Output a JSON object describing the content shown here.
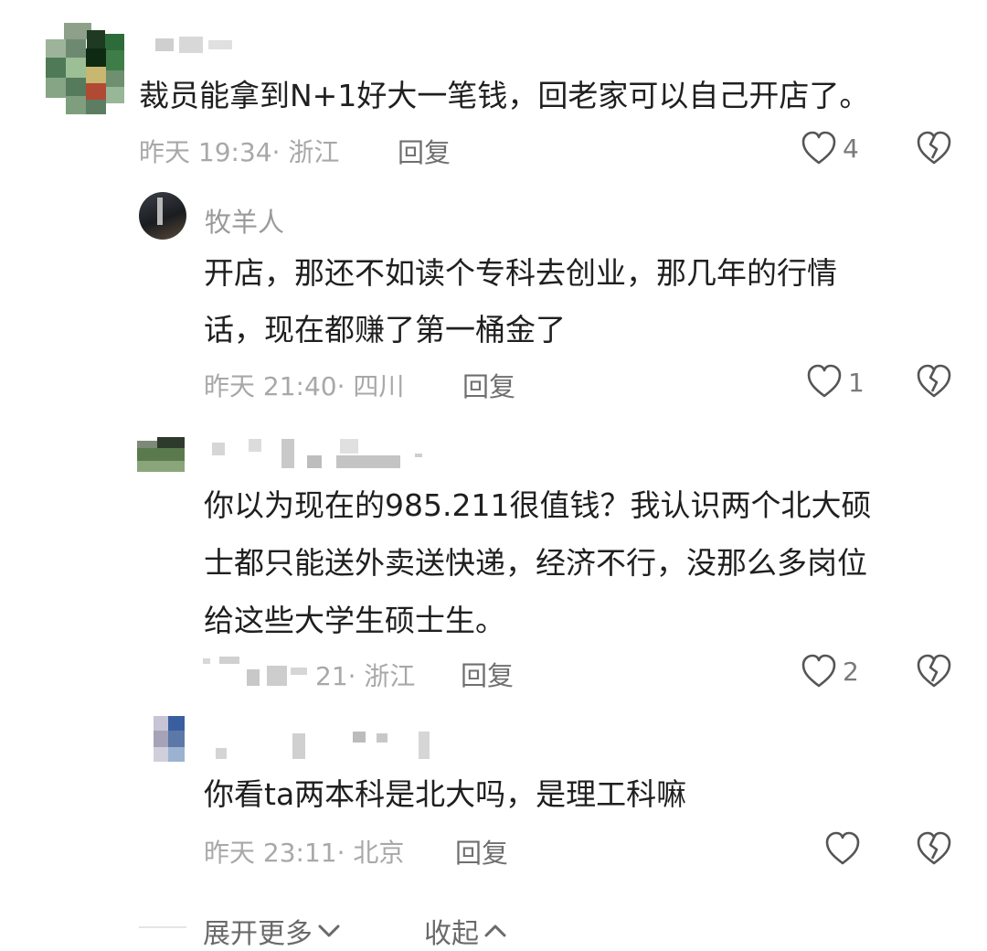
{
  "comments": [
    {
      "user_name": "",
      "text": "裁员能拿到N+1好大一笔钱，回老家可以自己开店了。",
      "time": "昨天 19:34· 浙江",
      "reply_label": "回复",
      "like_count": "4"
    },
    {
      "user_name": "牧羊人",
      "text_line1": "开店，那还不如读个专科去创业，那几年的行情",
      "text_line2": "话，现在都赚了第一桶金了",
      "time": "昨天 21:40· 四川",
      "reply_label": "回复",
      "like_count": "1"
    },
    {
      "user_name": "",
      "text_line1": "你以为现在的985.211很值钱？我认识两个北大硕",
      "text_line2": "士都只能送外卖送快递，经济不行，没那么多岗位",
      "text_line3": "给这些大学生硕士生。",
      "time": "21· 浙江",
      "reply_label": "回复",
      "like_count": "2"
    },
    {
      "user_name": "",
      "text": "你看ta两本科是北大吗，是理工科嘛",
      "time": "昨天 23:11· 北京",
      "reply_label": "回复",
      "like_count": ""
    }
  ],
  "footer": {
    "expand_label": "展开更多",
    "collapse_label": "收起"
  },
  "icons": {
    "like": "heart-outline-icon",
    "dislike": "broken-heart-icon",
    "expand": "chevron-down-icon",
    "collapse": "chevron-up-icon"
  }
}
